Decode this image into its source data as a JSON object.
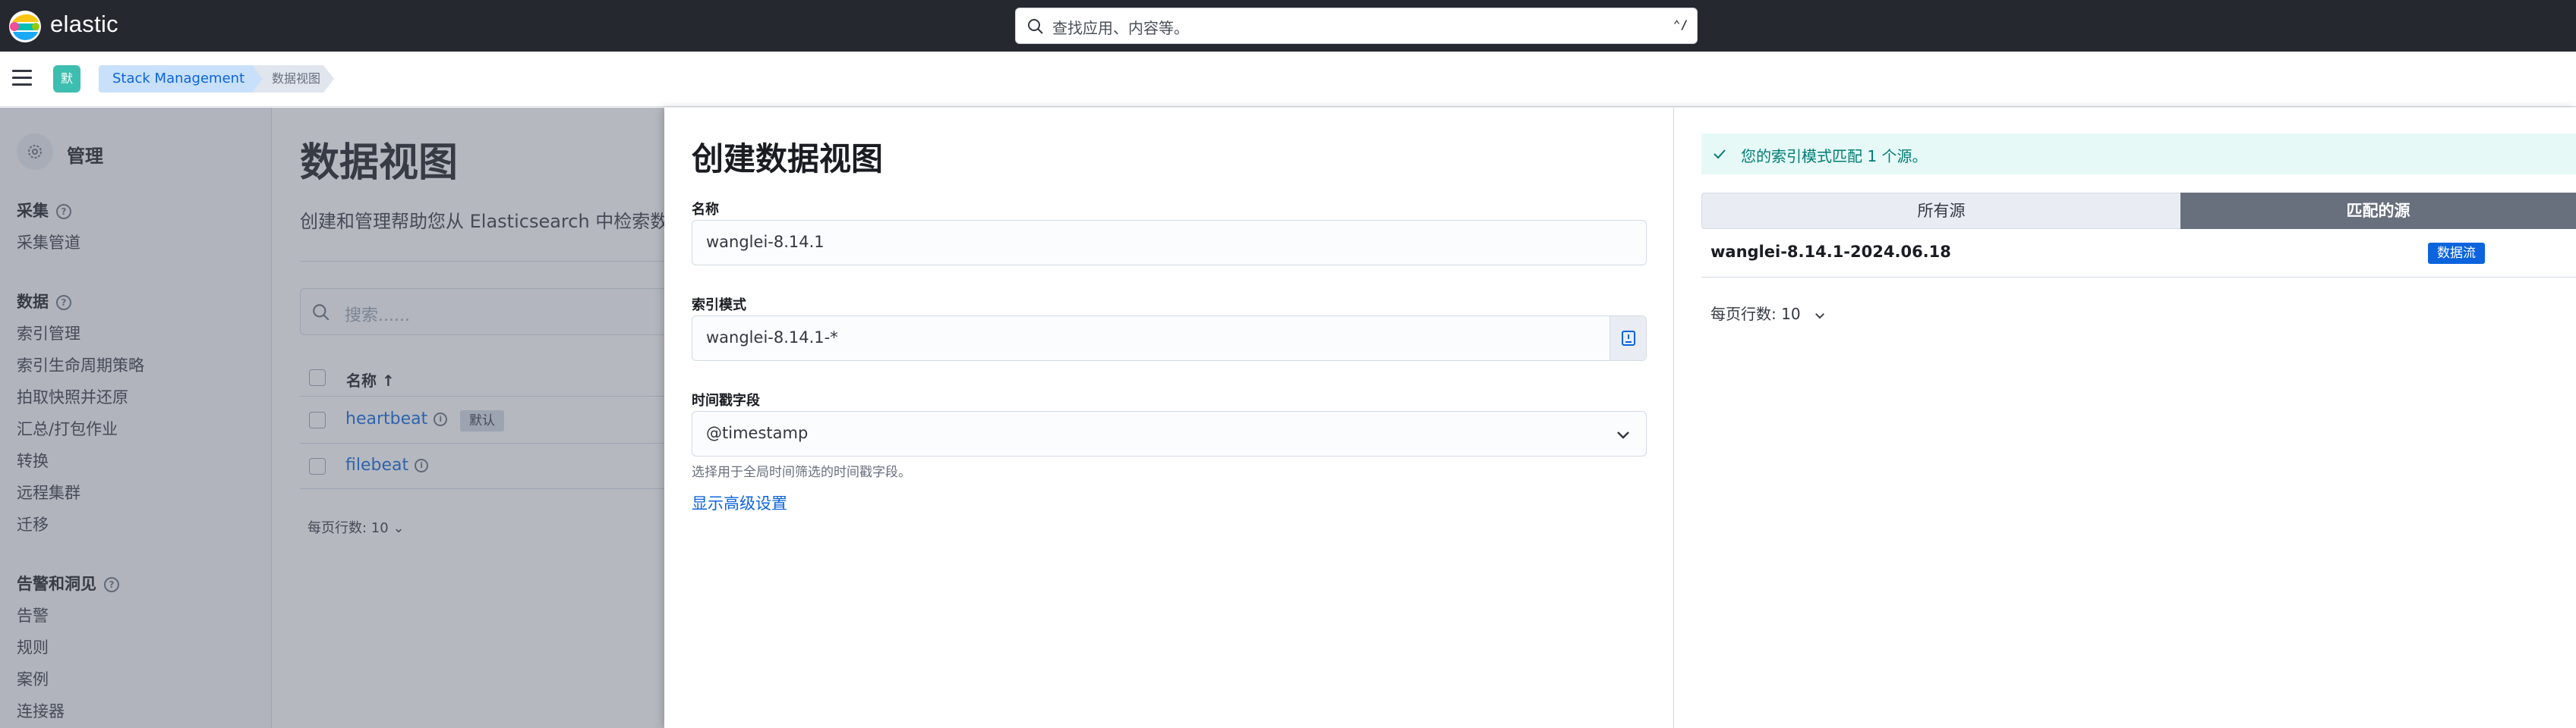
{
  "header": {
    "brand": "elastic",
    "search_placeholder": "查找应用、内容等。",
    "search_shortcut": "⌃/"
  },
  "breadcrumbs": {
    "space_initial": "默",
    "items": [
      "Stack Management",
      "数据视图"
    ]
  },
  "sidebar": {
    "title": "管理",
    "groups": [
      {
        "label": "采集",
        "items": [
          "采集管道"
        ]
      },
      {
        "label": "数据",
        "items": [
          "索引管理",
          "索引生命周期策略",
          "拍取快照并还原",
          "汇总/打包作业",
          "转换",
          "远程集群",
          "迁移"
        ]
      },
      {
        "label": "告警和洞见",
        "items": [
          "告警",
          "规则",
          "案例",
          "连接器"
        ]
      }
    ]
  },
  "page": {
    "title": "数据视图",
    "description": "创建和管理帮助您从 Elasticsearch 中检索数",
    "search_placeholder": "搜索......",
    "table": {
      "column_name": "名称 ↑",
      "rows": [
        {
          "name": "heartbeat",
          "badge": "默认"
        },
        {
          "name": "filebeat",
          "badge": ""
        }
      ]
    },
    "rows_per_page": "每页行数: 10"
  },
  "flyout": {
    "title": "创建数据视图",
    "name_label": "名称",
    "name_value": "wanglei-8.14.1",
    "index_pattern_label": "索引模式",
    "index_pattern_value": "wanglei-8.14.1-*",
    "timestamp_label": "时间戳字段",
    "timestamp_value": "@timestamp",
    "timestamp_help": "选择用于全局时间筛选的时间戳字段。",
    "advanced_link": "显示高级设置",
    "match_callout": "您的索引模式匹配 1 个源。",
    "tabs": [
      "所有源",
      "匹配的源"
    ],
    "active_tab": "匹配的源",
    "sources": [
      {
        "name": "wanglei-8.14.1-2024.06.18",
        "type": "数据流"
      }
    ],
    "rows_per_page": "每页行数: 10"
  },
  "colors": {
    "header_bg": "#25282f",
    "link": "#0b64dd",
    "success_text": "#017d73",
    "success_bg": "#e6f9f7",
    "active_tab_bg": "#69707d"
  }
}
